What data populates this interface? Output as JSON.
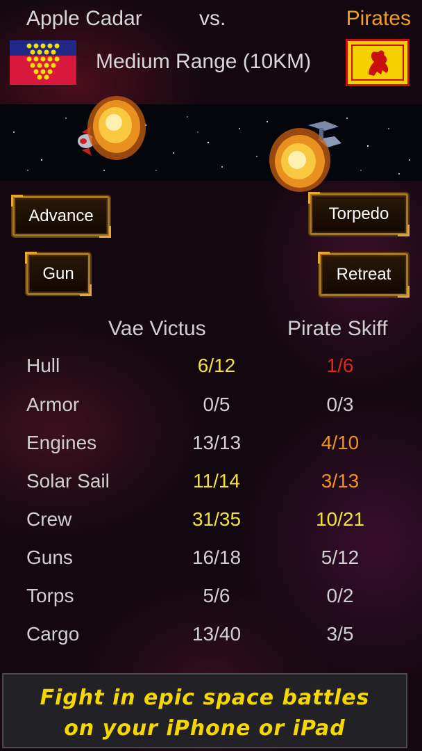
{
  "header": {
    "team_left": "Apple Cadar",
    "vs": "vs.",
    "team_right": "Pirates",
    "range": "Medium Range (10KM)"
  },
  "buttons": {
    "advance": "Advance",
    "gun": "Gun",
    "torpedo": "Torpedo",
    "retreat": "Retreat"
  },
  "ships": {
    "left": "Vae Victus",
    "right": "Pirate Skiff"
  },
  "stats": [
    {
      "label": "Hull",
      "left": "6/12",
      "right": "1/6",
      "left_color": "#f3e23a",
      "right_color": "#e0281e"
    },
    {
      "label": "Armor",
      "left": "0/5",
      "right": "0/3",
      "left_color": "#d0d0d0",
      "right_color": "#d0d0d0"
    },
    {
      "label": "Engines",
      "left": "13/13",
      "right": "4/10",
      "left_color": "#d0d0d0",
      "right_color": "#f0901e"
    },
    {
      "label": "Solar Sail",
      "left": "11/14",
      "right": "3/13",
      "left_color": "#f3e23a",
      "right_color": "#f0901e"
    },
    {
      "label": "Crew",
      "left": "31/35",
      "right": "10/21",
      "left_color": "#f3e23a",
      "right_color": "#f3e23a"
    },
    {
      "label": "Guns",
      "left": "16/18",
      "right": "5/12",
      "left_color": "#d0d0d0",
      "right_color": "#d0d0d0"
    },
    {
      "label": "Torps",
      "left": "5/6",
      "right": "0/2",
      "left_color": "#d0d0d0",
      "right_color": "#d0d0d0"
    },
    {
      "label": "Cargo",
      "left": "13/40",
      "right": "3/5",
      "left_color": "#d0d0d0",
      "right_color": "#d0d0d0"
    }
  ],
  "banner": {
    "line1": "Fight in epic space battles",
    "line2": "on your iPhone or iPad"
  }
}
